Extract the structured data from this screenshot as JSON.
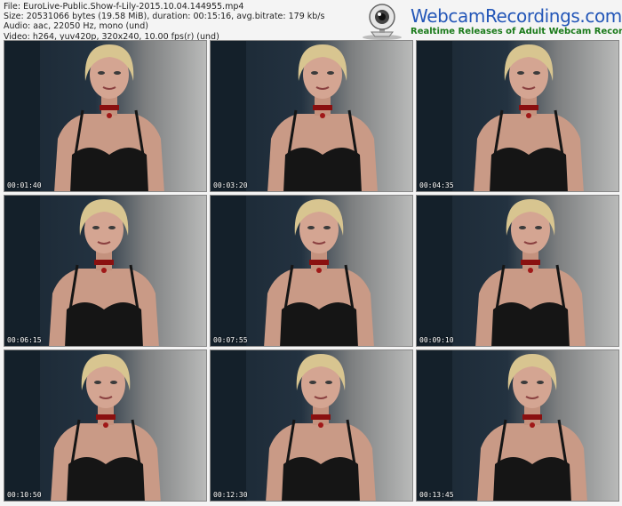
{
  "header": {
    "file_line": "File: EuroLive-Public.Show-f-Lily-2015.10.04.144955.mp4",
    "size_line": "Size: 20531066 bytes (19.58 MiB), duration: 00:15:16, avg.bitrate: 179 kb/s",
    "audio_line": "Audio: aac, 22050 Hz, mono (und)",
    "video_line": "Video: h264, yuv420p, 320x240, 10.00 fps(r) (und)"
  },
  "logo": {
    "brand": "WebcamRecordings.com",
    "tagline": "Realtime Releases of Adult Webcam Recordings",
    "brand_color": "#2457b8",
    "tagline_color": "#1a7a1a"
  },
  "thumbnails": [
    {
      "timestamp": "00:01:40"
    },
    {
      "timestamp": "00:03:20"
    },
    {
      "timestamp": "00:04:35"
    },
    {
      "timestamp": "00:06:15"
    },
    {
      "timestamp": "00:07:55"
    },
    {
      "timestamp": "00:09:10"
    },
    {
      "timestamp": "00:10:50"
    },
    {
      "timestamp": "00:12:30"
    },
    {
      "timestamp": "00:13:45"
    }
  ]
}
